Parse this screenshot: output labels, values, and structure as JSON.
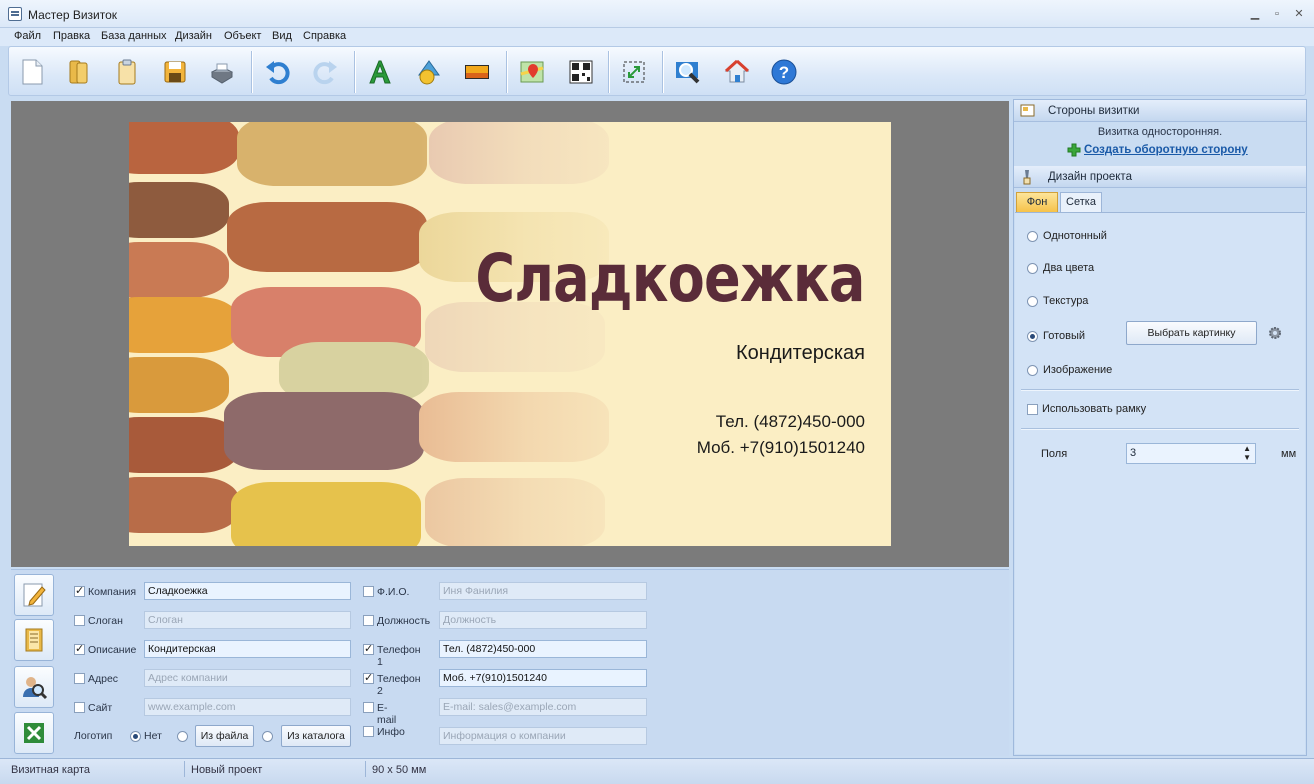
{
  "window": {
    "title": "Мастер Визиток"
  },
  "menu": [
    "Файл",
    "Правка",
    "База данных",
    "Дизайн",
    "Объект",
    "Вид",
    "Справка"
  ],
  "card": {
    "company": "Сладкоежка",
    "description": "Кондитерская",
    "phone1": "Тел. (4872)450-000",
    "phone2": "Моб. +7(910)1501240"
  },
  "fields": {
    "company": {
      "label": "Компания",
      "value": "Сладкоежка",
      "checked": true
    },
    "slogan": {
      "label": "Слоган",
      "placeholder": "Слоган",
      "checked": false
    },
    "description": {
      "label": "Описание",
      "value": "Кондитерская",
      "checked": true
    },
    "address": {
      "label": "Адрес",
      "placeholder": "Адрес компании",
      "checked": false
    },
    "site": {
      "label": "Сайт",
      "placeholder": "www.example.com",
      "checked": false
    },
    "logo": {
      "label": "Логотип",
      "none": "Нет",
      "from_file": "Из файла",
      "from_catalog": "Из каталога"
    },
    "fio": {
      "label": "Ф.И.О.",
      "placeholder": "Иня Фанилия",
      "checked": false
    },
    "position": {
      "label": "Должность",
      "placeholder": "Должность",
      "checked": false
    },
    "phone1": {
      "label": "Телефон 1",
      "value": "Тел. (4872)450-000",
      "checked": true
    },
    "phone2": {
      "label": "Телефон 2",
      "value": "Моб. +7(910)1501240",
      "checked": true
    },
    "email": {
      "label": "E-mail",
      "placeholder": "E-mail: sales@example.com",
      "checked": false
    },
    "info": {
      "label": "Инфо",
      "placeholder": "Информация о компании",
      "checked": false
    }
  },
  "sides": {
    "header": "Стороны визитки",
    "note": "Визитка односторонняя.",
    "create_back": "Создать оборотную сторону"
  },
  "design": {
    "header": "Дизайн проекта",
    "tabs": [
      "Фон",
      "Сетка"
    ],
    "active_tab": "Фон",
    "options": [
      "Однотонный",
      "Два цвета",
      "Текстура",
      "Готовый",
      "Изображение"
    ],
    "selected": "Готовый",
    "choose_picture": "Выбрать картинку",
    "use_frame": "Использовать рамку",
    "margins_label": "Поля",
    "margins_value": "3",
    "margins_unit": "мм"
  },
  "status": {
    "type": "Визитная карта",
    "project": "Новый проект",
    "size": "90 x 50 мм"
  },
  "colors": {
    "accent_tab": "#f6c24a",
    "card_text": "#5a2c39",
    "link": "#1a5aa8"
  }
}
